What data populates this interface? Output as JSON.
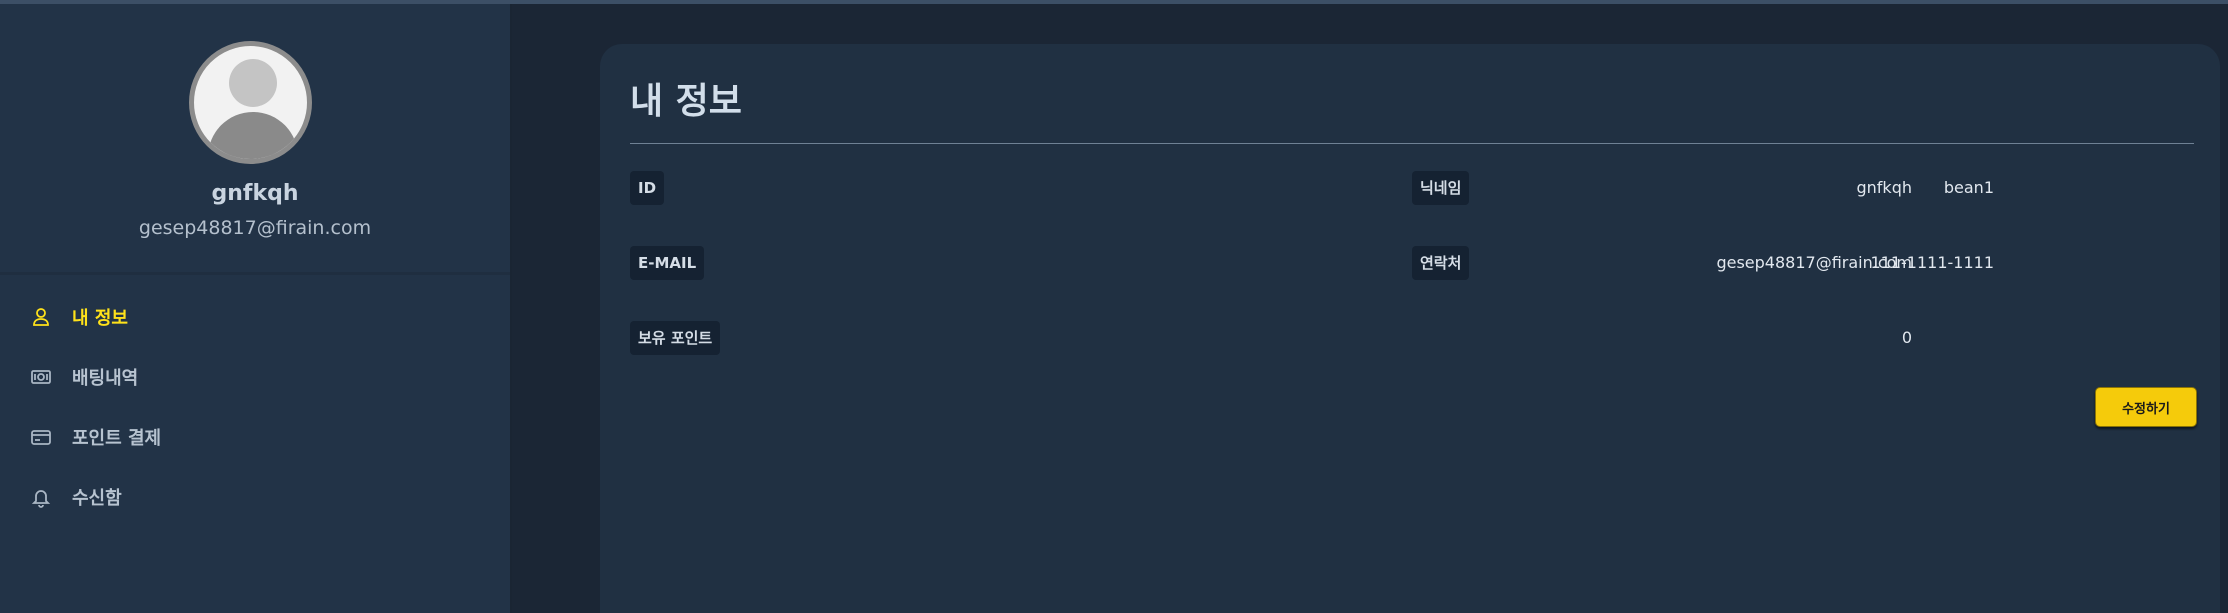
{
  "profile": {
    "username": "gnfkqh",
    "email": "gesep48817@firain.com"
  },
  "nav": {
    "items": [
      {
        "label": "내 정보",
        "icon": "user-icon",
        "active": true
      },
      {
        "label": "배팅내역",
        "icon": "cash-icon",
        "active": false
      },
      {
        "label": "포인트 결제",
        "icon": "credit-card-icon",
        "active": false
      },
      {
        "label": "수신함",
        "icon": "bell-icon",
        "active": false
      }
    ]
  },
  "main": {
    "title": "내 정보",
    "fields": {
      "id": {
        "label": "ID",
        "value": "gnfkqh"
      },
      "nickname": {
        "label": "닉네임",
        "value": "bean1"
      },
      "email": {
        "label": "E-MAIL",
        "value": "gesep48817@firain.com"
      },
      "phone": {
        "label": "연락처",
        "value": "111-1111-1111"
      },
      "points": {
        "label": "보유 포인트",
        "value": "0"
      }
    },
    "edit_label": "수정하기"
  },
  "colors": {
    "accent": "#ffe21a",
    "button": "#f5cb0b",
    "sidebar": "#223347",
    "card": "#203042",
    "background": "#1b2635"
  }
}
